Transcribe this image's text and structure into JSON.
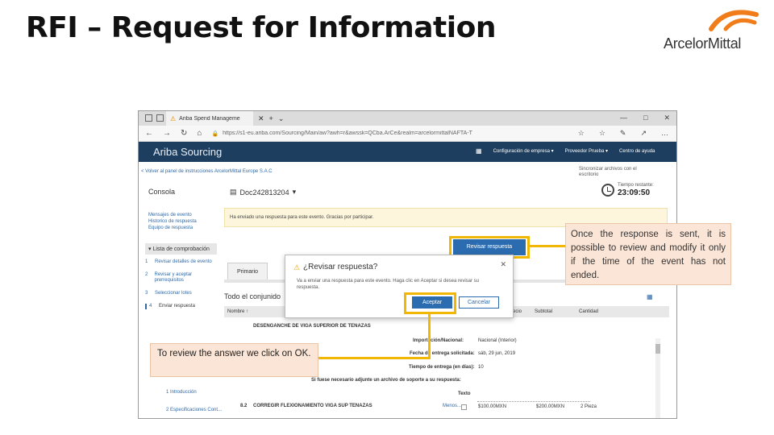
{
  "slide": {
    "title": "RFI – Request for Information",
    "logo_text": "ArcelorMittal",
    "accent_color": "#f2b705",
    "callout_bg": "#fbe5d6"
  },
  "browser": {
    "tab_title": "Ariba Spend Manageme",
    "url": "https://s1-eu.ariba.com/Sourcing/Main/aw?awh=r&awssk=QCba.ArCe&realm=arcelormittalNAFTA-T",
    "window_controls": [
      "—",
      "□",
      "✕"
    ]
  },
  "app": {
    "title": "Ariba Sourcing",
    "header_bg": "#1d3e5e",
    "menu": [
      "Configuración de empresa ▾",
      "Proveedor Prueba ▾",
      "Centro de ayuda"
    ],
    "back_link": "< Volver al panel de instrucciones ArcelorMittal Europe S.A.C",
    "sync_text": "Sincronizar archivos con el escritorio",
    "console": "Consola",
    "doc_id": "Doc242813204",
    "time_label": "Tiempo restante:",
    "time_value": "23:09:50",
    "left_links": [
      "Mensajes de evento",
      "Historico de respuesta",
      "Equipo de respuesta"
    ],
    "checklist_header": "▾ Lista de comprobación",
    "checklist": [
      {
        "num": "1",
        "label": "Revisar detalles de evento"
      },
      {
        "num": "2",
        "label": "Revisar y aceptar prerrequisitos"
      },
      {
        "num": "3",
        "label": "Seleccionar lotes"
      },
      {
        "num": "4",
        "label": "Enviar respuesta"
      }
    ],
    "sub_items": [
      {
        "num": "1",
        "label": "Introducción"
      },
      {
        "num": "2",
        "label": "Especificaciones Cont..."
      }
    ],
    "message": "Ha enviado una respuesta para este evento. Gracias por participar.",
    "review_button": "Revisar respuesta",
    "primary_tab": "Primario",
    "all_content": "Todo el conjunido",
    "table_headers": [
      "Nombre ↑",
      "Precio",
      "Subtotal",
      "Cantidad"
    ],
    "row_title": "DESENGANCHE DE VIGA SUPERIOR DE TENAZAS",
    "fields": [
      {
        "label": "Importación/Nacional:",
        "value": "Nacional (Interior)"
      },
      {
        "label": "Fecha de entrega solicitada:",
        "value": "sáb, 29 jun, 2019"
      },
      {
        "label": "Tiempo de entrega (en días):",
        "value": "10"
      },
      {
        "label": "Si fuese necesario adjunte un archivo de soporte a su respuesta:",
        "value": ""
      },
      {
        "label": "Texto",
        "value": ""
      }
    ],
    "row8": {
      "num": "8.2",
      "name": "CORREGIR FLEXIONAMIENTO VIGA SUP TENAZAS",
      "more": "Menos...",
      "price": "$100.00MXN",
      "subtotal": "$200.00MXN",
      "qty": "2 Pieza"
    }
  },
  "dialog": {
    "title": "¿Revisar respuesta?",
    "text": "Va a enviar una respuesta para este evento. Haga clic en Aceptar si desea revisar su respuesta.",
    "accept": "Aceptar",
    "cancel": "Cancelar"
  },
  "callouts": {
    "right": "Once the response is sent, it is possible to review and modify it only if the time of the event has not ended.",
    "left": "To review the answer we click on OK."
  }
}
